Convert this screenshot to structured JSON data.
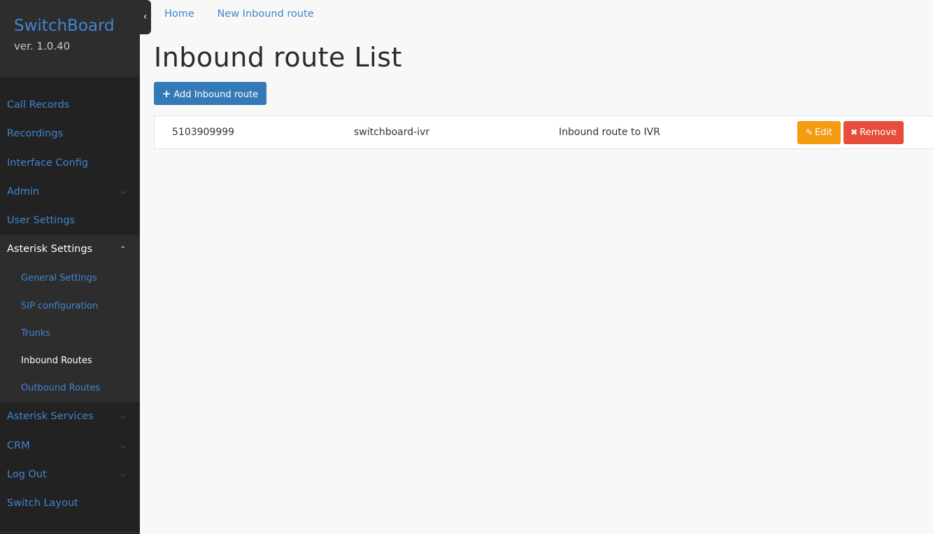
{
  "brand": {
    "title": "SwitchBoard",
    "version": "ver. 1.0.40"
  },
  "sidebar": {
    "items": [
      {
        "label": "Call Records"
      },
      {
        "label": "Recordings"
      },
      {
        "label": "Interface Config"
      },
      {
        "label": "Admin",
        "icon": "chevron-down-icon"
      },
      {
        "label": "User Settings"
      },
      {
        "label": "Asterisk Settings",
        "icon": "chevron-up-icon"
      },
      {
        "label": "Asterisk Services",
        "icon": "chevron-down-icon"
      },
      {
        "label": "CRM",
        "icon": "chevron-down-icon"
      },
      {
        "label": "Log Out",
        "icon": "chevron-down-icon"
      },
      {
        "label": "Switch Layout"
      }
    ],
    "submenu": [
      {
        "label": "General Settings"
      },
      {
        "label": "SIP configuration"
      },
      {
        "label": "Trunks"
      },
      {
        "label": "Inbound Routes"
      },
      {
        "label": "Outbound Routes"
      }
    ]
  },
  "breadcrumb": {
    "home": "Home",
    "current": "New Inbound route"
  },
  "page": {
    "title": "Inbound route List",
    "add_button": "Add Inbound route"
  },
  "table": {
    "rows": [
      {
        "number": "5103909999",
        "context": "switchboard-ivr",
        "description": "Inbound route to IVR"
      }
    ],
    "edit_label": "Edit",
    "remove_label": "Remove"
  },
  "colors": {
    "sidebar_bg": "#222222",
    "link": "#3f86cf",
    "primary": "#337ab7",
    "warning": "#f39c12",
    "danger": "#e74c3c"
  }
}
